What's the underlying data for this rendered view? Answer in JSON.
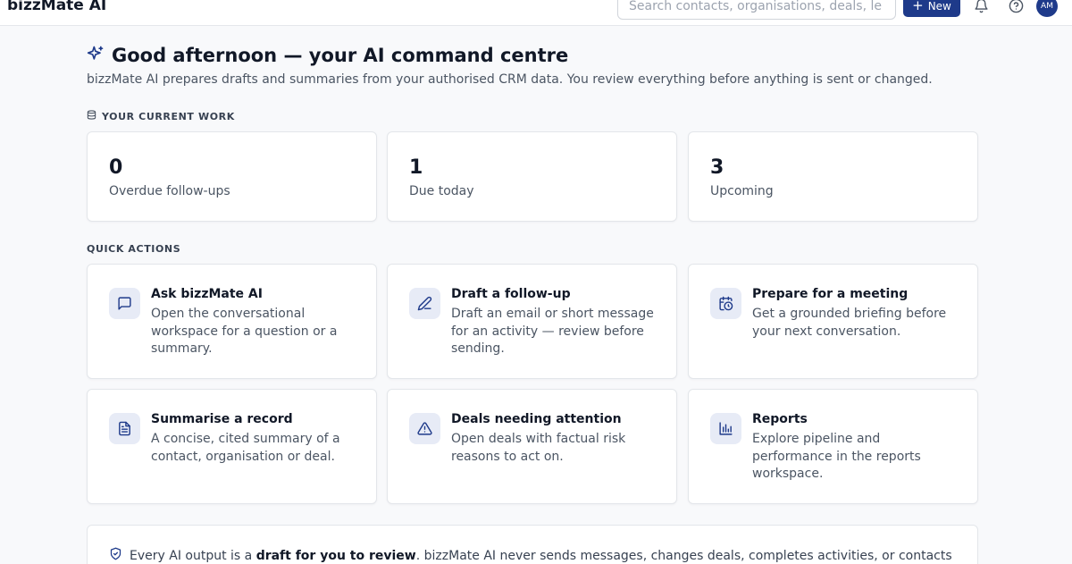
{
  "header": {
    "brand": "bizzMate AI",
    "search_placeholder": "Search contacts, organisations, deals, le",
    "new_label": "New",
    "avatar_initials": "AM"
  },
  "greeting": {
    "title": "Good afternoon — your AI command centre",
    "subtitle": "bizzMate AI prepares drafts and summaries from your authorised CRM data. You review everything before anything is sent or changed."
  },
  "current_work": {
    "label": "YOUR CURRENT WORK",
    "stats": [
      {
        "value": "0",
        "label": "Overdue follow-ups"
      },
      {
        "value": "1",
        "label": "Due today"
      },
      {
        "value": "3",
        "label": "Upcoming"
      }
    ]
  },
  "quick_actions": {
    "label": "QUICK ACTIONS",
    "items": [
      {
        "icon": "chat-bubble-icon",
        "title": "Ask bizzMate AI",
        "description": "Open the conversational workspace for a question or a summary."
      },
      {
        "icon": "pencil-icon",
        "title": "Draft a follow-up",
        "description": "Draft an email or short message for an activity — review before sending."
      },
      {
        "icon": "calendar-clock-icon",
        "title": "Prepare for a meeting",
        "description": "Get a grounded briefing before your next conversation."
      },
      {
        "icon": "document-icon",
        "title": "Summarise a record",
        "description": "A concise, cited summary of a contact, organisation or deal."
      },
      {
        "icon": "warning-triangle-icon",
        "title": "Deals needing attention",
        "description": "Open deals with factual risk reasons to act on."
      },
      {
        "icon": "bar-chart-icon",
        "title": "Reports",
        "description": "Explore pipeline and performance in the reports workspace."
      }
    ]
  },
  "notice": {
    "prefix": "Every AI output is a ",
    "emphasis": "draft for you to review",
    "suffix": ". bizzMate AI never sends messages, changes deals, completes activities, or contacts"
  },
  "colors": {
    "accent": "#1e3a8a",
    "icon_tile": "#e7ebf6",
    "background": "#f8f9fb"
  }
}
